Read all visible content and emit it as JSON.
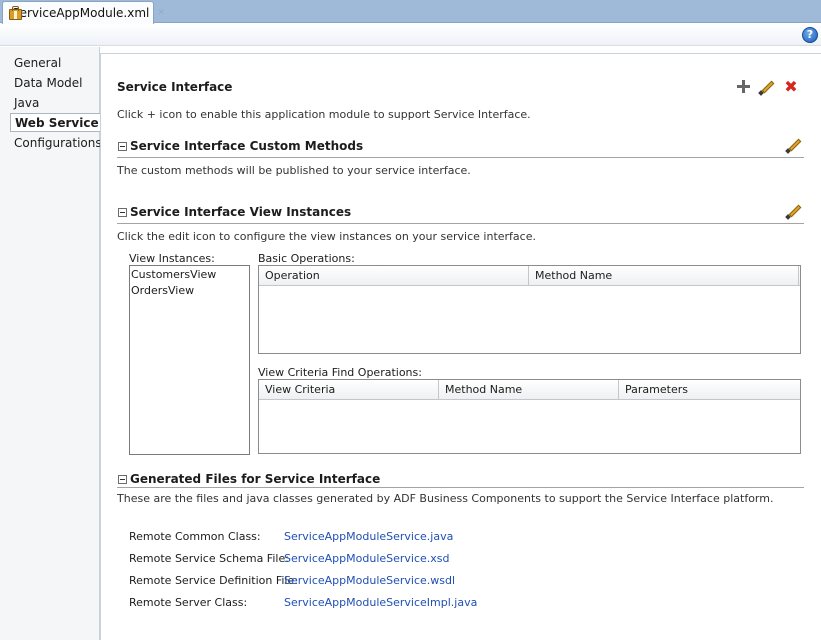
{
  "tab": {
    "title": "ServiceAppModule.xml",
    "close": "✕"
  },
  "help": "?",
  "nav": [
    {
      "label": "General"
    },
    {
      "label": "Data Model"
    },
    {
      "label": "Java"
    },
    {
      "label": "Web Service",
      "selected": true
    },
    {
      "label": "Configurations"
    }
  ],
  "service_interface": {
    "title": "Service Interface",
    "description": "Click + icon to enable this application module to support Service Interface."
  },
  "custom_methods": {
    "title": "Service Interface Custom Methods",
    "description": "The custom methods will be published to your service interface."
  },
  "view_instances": {
    "title": "Service Interface View Instances",
    "description": "Click the edit icon to configure the view instances on your service interface.",
    "list_label": "View Instances:",
    "items": [
      "CustomersView",
      "OrdersView"
    ],
    "basic_ops_label": "Basic Operations:",
    "basic_ops_columns": [
      "Operation",
      "Method Name"
    ],
    "criteria_label": "View Criteria Find Operations:",
    "criteria_columns": [
      "View Criteria",
      "Method Name",
      "Parameters"
    ]
  },
  "generated_files": {
    "title": "Generated Files for Service Interface",
    "description": "These are the files and java classes generated by ADF Business Components to support the Service Interface platform.",
    "rows": [
      {
        "label": "Remote Common Class:",
        "value": "ServiceAppModuleService.java"
      },
      {
        "label": "Remote Service Schema File:",
        "value": "ServiceAppModuleService.xsd"
      },
      {
        "label": "Remote Service Definition File:",
        "value": "ServiceAppModuleService.wsdl"
      },
      {
        "label": "Remote Server Class:",
        "value": "ServiceAppModuleServiceImpl.java"
      }
    ]
  },
  "colors": {
    "link": "#1f4fb5",
    "delete": "#d8261c",
    "tabstrip": "#9fbad9"
  }
}
